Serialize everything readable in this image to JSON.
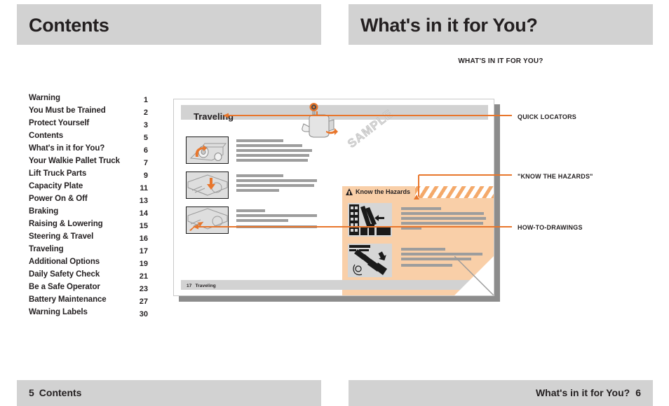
{
  "spread": {
    "left_page": {
      "header_title": "Contents",
      "footer_page_number": "5",
      "footer_label": "Contents"
    },
    "right_page": {
      "header_title": "What's in it for You?",
      "eyebrow": "WHAT'S IN IT FOR YOU?",
      "footer_page_number": "6",
      "footer_label": "What's in it for You?"
    }
  },
  "toc": {
    "entries": [
      {
        "label": "Warning",
        "page": "1"
      },
      {
        "label": "You Must be Trained",
        "page": "2"
      },
      {
        "label": "Protect Yourself",
        "page": "3"
      },
      {
        "label": "Contents",
        "page": "5"
      },
      {
        "label": "What's in it for You?",
        "page": "6"
      },
      {
        "label": "Your Walkie Pallet Truck",
        "page": "7"
      },
      {
        "label": "Lift Truck Parts",
        "page": "9"
      },
      {
        "label": "Capacity Plate",
        "page": "11"
      },
      {
        "label": "Power On & Off",
        "page": "13"
      },
      {
        "label": "Braking",
        "page": "14"
      },
      {
        "label": "Raising & Lowering",
        "page": "15"
      },
      {
        "label": "Steering & Travel",
        "page": "16"
      },
      {
        "label": "Traveling",
        "page": "17"
      },
      {
        "label": "Additional Options",
        "page": "19"
      },
      {
        "label": "Daily Safety Check",
        "page": "21"
      },
      {
        "label": "Be a Safe Operator",
        "page": "23"
      },
      {
        "label": "Battery Maintenance",
        "page": "27"
      },
      {
        "label": "Warning Labels",
        "page": "30"
      }
    ]
  },
  "sample_page": {
    "title": "Traveling",
    "watermark": "SAMPLE",
    "footer_page_number": "17",
    "footer_label": "Traveling",
    "hazard_panel": {
      "title": "Know the Hazards"
    }
  },
  "annotations": [
    {
      "label": "QUICK LOCATORS"
    },
    {
      "label": "\"KNOW THE HAZARDS\""
    },
    {
      "label": "HOW-TO-DRAWINGS"
    }
  ],
  "colors": {
    "accent_orange": "#e8762c",
    "band_gray": "#d2d2d2",
    "hazard_fill": "#f9cfa8",
    "hazard_stripe": "#f4a96a",
    "ink": "#231f20"
  }
}
